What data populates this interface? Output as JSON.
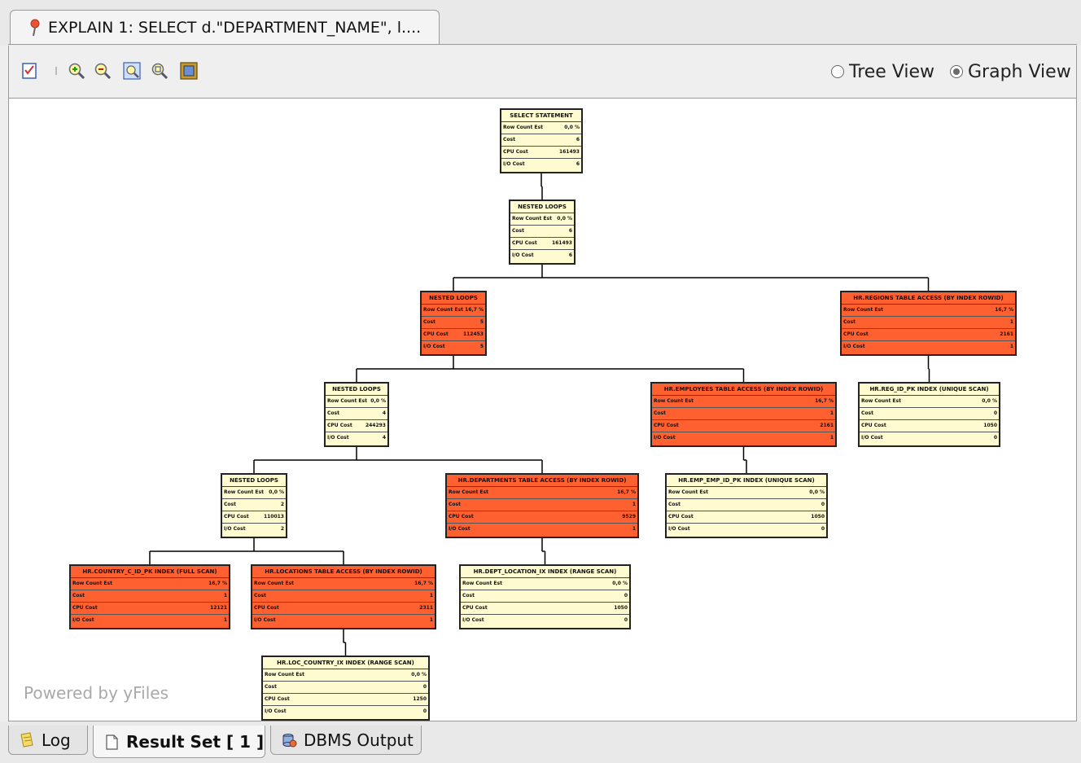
{
  "editor_tab": {
    "title": "EXPLAIN 1: SELECT d.\"DEPARTMENT_NAME\", l...."
  },
  "toolbar": {
    "icons": [
      "checklist-icon",
      "zoom-in-icon",
      "zoom-out-icon",
      "zoom-fit-icon",
      "zoom-actual-icon",
      "export-image-icon"
    ],
    "view_options": [
      {
        "label": "Tree View",
        "selected": false
      },
      {
        "label": "Graph View",
        "selected": true
      }
    ]
  },
  "graph": {
    "row_labels": [
      "Row Count Est",
      "Cost",
      "CPU Cost",
      "I/O Cost"
    ],
    "nodes": [
      {
        "id": "n1",
        "title": "SELECT STATEMENT",
        "hot": false,
        "values": [
          "0,0 %",
          "6",
          "161493",
          "6"
        ]
      },
      {
        "id": "n2",
        "title": "NESTED LOOPS",
        "hot": false,
        "values": [
          "0,0 %",
          "6",
          "161493",
          "6"
        ]
      },
      {
        "id": "n3",
        "title": "NESTED LOOPS",
        "hot": true,
        "values": [
          "16,7 %",
          "5",
          "112453",
          "5"
        ]
      },
      {
        "id": "n4",
        "title": "HR.REGIONS TABLE ACCESS (BY INDEX ROWID)",
        "hot": true,
        "values": [
          "16,7 %",
          "1",
          "2161",
          "1"
        ]
      },
      {
        "id": "n5",
        "title": "NESTED LOOPS",
        "hot": false,
        "values": [
          "0,0 %",
          "4",
          "244293",
          "4"
        ]
      },
      {
        "id": "n6",
        "title": "HR.EMPLOYEES TABLE ACCESS (BY INDEX ROWID)",
        "hot": true,
        "values": [
          "16,7 %",
          "1",
          "2161",
          "1"
        ]
      },
      {
        "id": "n7",
        "title": "HR.REG_ID_PK INDEX (UNIQUE SCAN)",
        "hot": false,
        "values": [
          "0,0 %",
          "0",
          "1050",
          "0"
        ]
      },
      {
        "id": "n8",
        "title": "NESTED LOOPS",
        "hot": false,
        "values": [
          "0,0 %",
          "2",
          "110013",
          "2"
        ]
      },
      {
        "id": "n9",
        "title": "HR.DEPARTMENTS TABLE ACCESS (BY INDEX ROWID)",
        "hot": true,
        "values": [
          "16,7 %",
          "1",
          "9529",
          "1"
        ]
      },
      {
        "id": "n10",
        "title": "HR.EMP_EMP_ID_PK INDEX (UNIQUE SCAN)",
        "hot": false,
        "values": [
          "0,0 %",
          "0",
          "1050",
          "0"
        ]
      },
      {
        "id": "n11",
        "title": "HR.COUNTRY_C_ID_PK INDEX (FULL SCAN)",
        "hot": true,
        "values": [
          "16,7 %",
          "1",
          "12121",
          "1"
        ]
      },
      {
        "id": "n12",
        "title": "HR.LOCATIONS TABLE ACCESS (BY INDEX ROWID)",
        "hot": true,
        "values": [
          "16,7 %",
          "1",
          "2311",
          "1"
        ]
      },
      {
        "id": "n13",
        "title": "HR.DEPT_LOCATION_IX INDEX (RANGE SCAN)",
        "hot": false,
        "values": [
          "0,0 %",
          "0",
          "1050",
          "0"
        ]
      },
      {
        "id": "n14",
        "title": "HR.LOC_COUNTRY_IX INDEX (RANGE SCAN)",
        "hot": false,
        "values": [
          "0,0 %",
          "0",
          "1250",
          "0"
        ]
      }
    ],
    "edges": [
      [
        "n1",
        "n2"
      ],
      [
        "n2",
        "n3"
      ],
      [
        "n2",
        "n4"
      ],
      [
        "n3",
        "n5"
      ],
      [
        "n3",
        "n6"
      ],
      [
        "n4",
        "n7"
      ],
      [
        "n5",
        "n8"
      ],
      [
        "n5",
        "n9"
      ],
      [
        "n6",
        "n10"
      ],
      [
        "n8",
        "n11"
      ],
      [
        "n8",
        "n12"
      ],
      [
        "n9",
        "n13"
      ],
      [
        "n12",
        "n14"
      ]
    ],
    "watermark": "Powered by yFiles"
  },
  "bottom_tabs": [
    {
      "label": "Log",
      "icon": "log-icon",
      "active": false
    },
    {
      "label": "Result Set [ 1 ]",
      "icon": "result-set-icon",
      "active": true
    },
    {
      "label": "DBMS Output",
      "icon": "dbms-output-icon",
      "active": false
    }
  ]
}
